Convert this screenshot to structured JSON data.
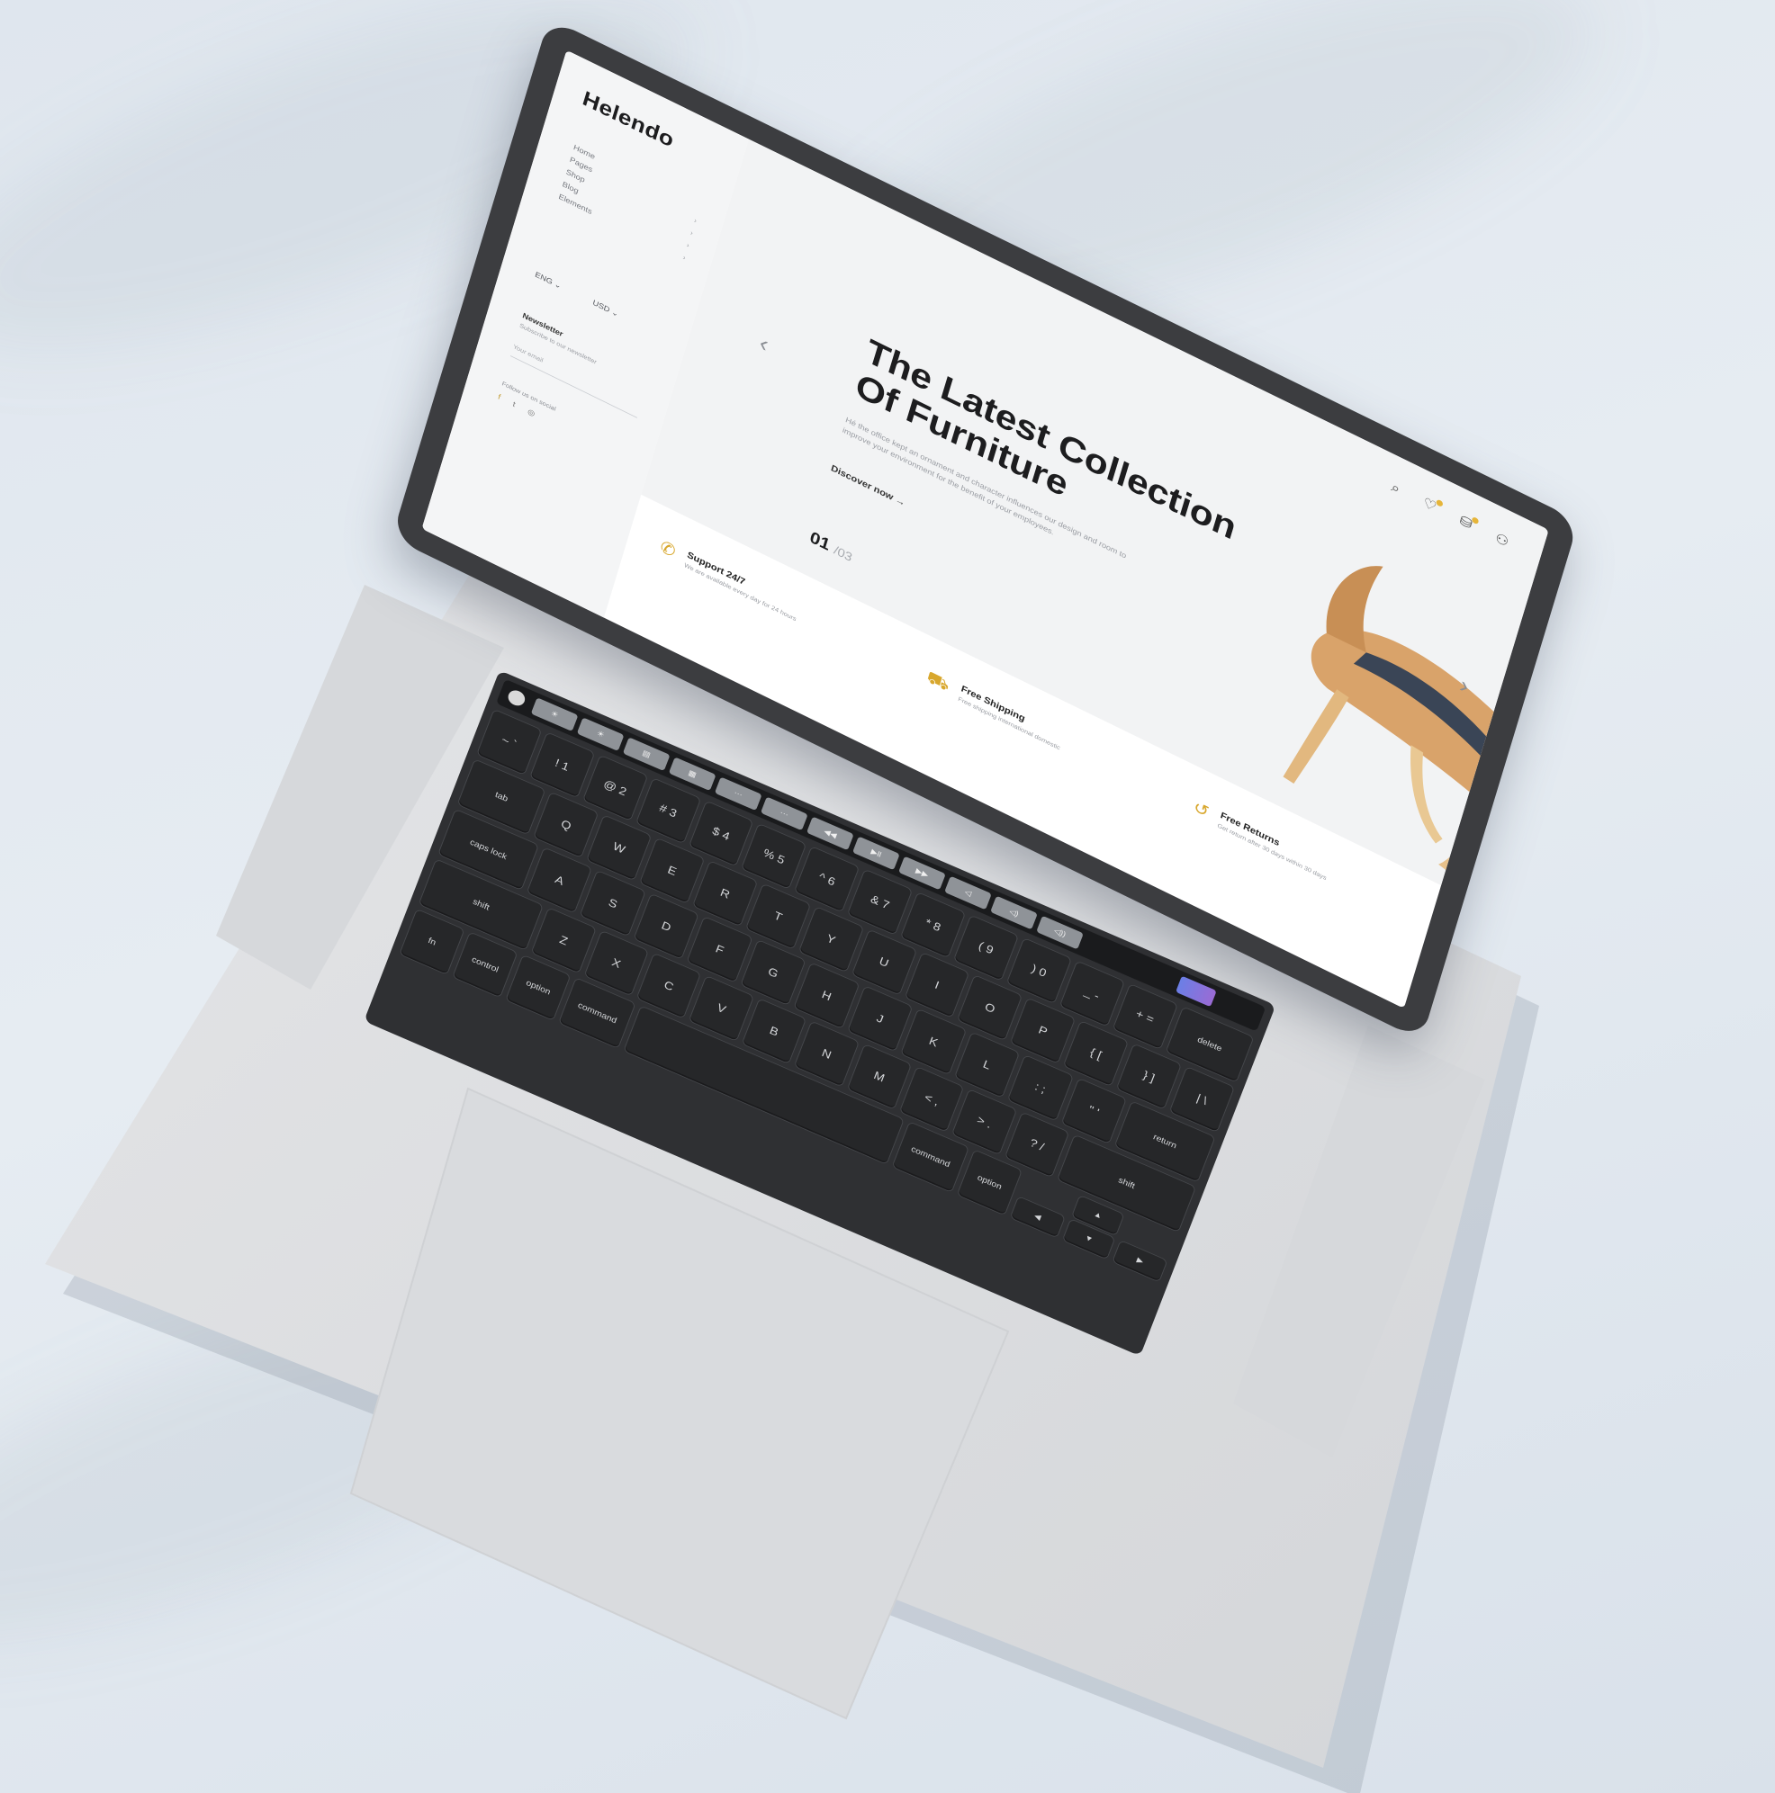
{
  "site": {
    "logo": "Helendo",
    "menu": [
      {
        "label": "Home",
        "has_submenu": false
      },
      {
        "label": "Pages",
        "has_submenu": true
      },
      {
        "label": "Shop",
        "has_submenu": true
      },
      {
        "label": "Blog",
        "has_submenu": true
      },
      {
        "label": "Elements",
        "has_submenu": true
      }
    ],
    "selectors": {
      "currency": "ENG",
      "language": "USD"
    },
    "newsletter": {
      "title": "Newsletter",
      "description": "Subscribe to our newsletter",
      "input_placeholder": "Your email"
    },
    "follow": {
      "label": "Follow us on social"
    },
    "header_icons": [
      "search-icon",
      "wishlist-icon",
      "cart-icon",
      "account-icon"
    ],
    "hero": {
      "title_line1": "The Latest Collection",
      "title_line2": "Of Furniture",
      "description": "Hé the office kept an ornament and character influences our design and room to improve your environment for the benefit of your employees.",
      "cta": "Discover now →",
      "slide_current": "01",
      "slide_total": "/03"
    },
    "features": [
      {
        "icon": "phone-icon",
        "title": "Support 24/7",
        "description": "We are available every day for 24 hours"
      },
      {
        "icon": "truck-icon",
        "title": "Free Shipping",
        "description": "Free shipping international domestic"
      },
      {
        "icon": "return-icon",
        "title": "Free Returns",
        "description": "Get return after 30 days within 30 days"
      }
    ],
    "colors": {
      "accent": "#d8a72d",
      "text_dark": "#1d1d1f",
      "hero_bg": "#f2f3f4",
      "chair_wood": "#d9a36a",
      "chair_fabric": "#3a4556"
    }
  },
  "keyboard": {
    "touchbar": [
      "☀",
      "☀",
      "▤",
      "▦",
      "···",
      "···",
      "◀◀",
      "▶ll",
      "▶▶",
      "◁",
      "◁)",
      "◁))"
    ],
    "rows": [
      [
        "~ `",
        "! 1",
        "@ 2",
        "# 3",
        "$ 4",
        "% 5",
        "^ 6",
        "& 7",
        "* 8",
        "( 9",
        ") 0",
        "_ -",
        "+ =",
        "delete"
      ],
      [
        "tab",
        "Q",
        "W",
        "E",
        "R",
        "T",
        "Y",
        "U",
        "I",
        "O",
        "P",
        "{ [",
        "} ]",
        "| \\"
      ],
      [
        "caps lock",
        "A",
        "S",
        "D",
        "F",
        "G",
        "H",
        "J",
        "K",
        "L",
        ": ;",
        "\" '",
        "return"
      ],
      [
        "shift",
        "Z",
        "X",
        "C",
        "V",
        "B",
        "N",
        "M",
        "< ,",
        "> .",
        "? /",
        "shift"
      ],
      [
        "fn",
        "control",
        "option",
        "command",
        "",
        "command",
        "option"
      ]
    ],
    "arrows": {
      "left": "◀",
      "up": "▲",
      "down": "▼",
      "right": "▶"
    }
  }
}
